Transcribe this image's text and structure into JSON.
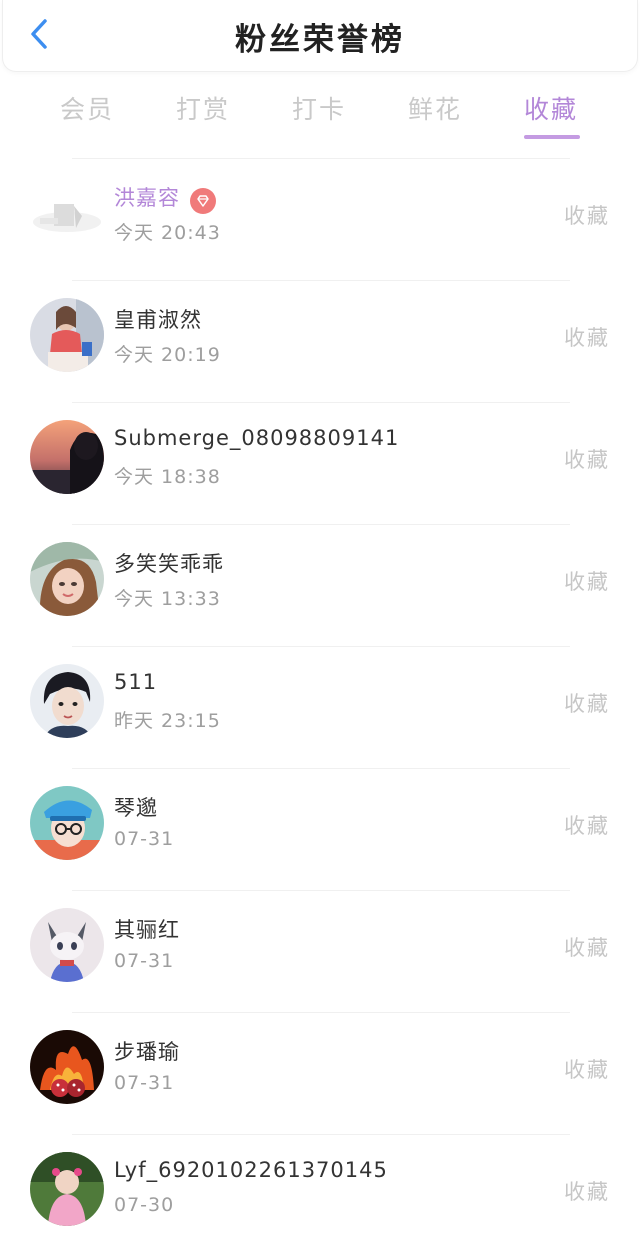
{
  "header": {
    "title": "粉丝荣誉榜"
  },
  "tabs": [
    {
      "label": "会员"
    },
    {
      "label": "打赏"
    },
    {
      "label": "打卡"
    },
    {
      "label": "鲜花"
    },
    {
      "label": "收藏"
    }
  ],
  "active_tab": "收藏",
  "colors": {
    "accent": "#b387d8",
    "back_icon": "#3d8ef0",
    "badge": "#f07a7a"
  },
  "fans": [
    {
      "name": "洪嘉容",
      "time": "今天 20:43",
      "action": "收藏",
      "vip": true
    },
    {
      "name": "皇甫淑然",
      "time": "今天 20:19",
      "action": "收藏"
    },
    {
      "name": "Submerge_08098809141",
      "time": "今天 18:38",
      "action": "收藏"
    },
    {
      "name": "多笑笑乖乖",
      "time": "今天 13:33",
      "action": "收藏"
    },
    {
      "name": "511",
      "time": "昨天 23:15",
      "action": "收藏"
    },
    {
      "name": "琴邈",
      "time": "07-31",
      "action": "收藏"
    },
    {
      "name": "其骊红",
      "time": "07-31",
      "action": "收藏"
    },
    {
      "name": "步璠瑜",
      "time": "07-31",
      "action": "收藏"
    },
    {
      "name": "Lyf_6920102261370145",
      "time": "07-30",
      "action": "收藏"
    }
  ]
}
